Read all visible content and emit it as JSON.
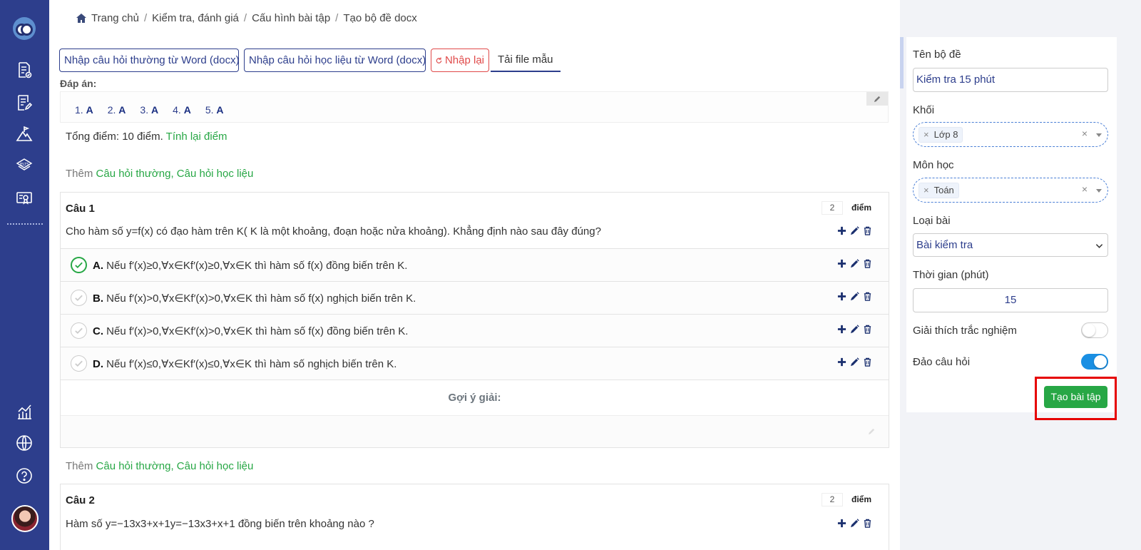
{
  "breadcrumb": {
    "home": "Trang chủ",
    "items": [
      "Kiểm tra, đánh giá",
      "Cấu hình bài tập",
      "Tạo bộ đề docx"
    ],
    "separator": "/"
  },
  "toolbar": {
    "import_normal": "Nhập câu hỏi thường từ Word (docx)",
    "import_material": "Nhập câu hỏi học liệu từ Word (docx)",
    "reset": "Nhập lại",
    "download_template": "Tải file mẫu"
  },
  "answers": {
    "label": "Đáp án:",
    "items": [
      {
        "num": "1.",
        "ans": "A"
      },
      {
        "num": "2.",
        "ans": "A"
      },
      {
        "num": "3.",
        "ans": "A"
      },
      {
        "num": "4.",
        "ans": "A"
      },
      {
        "num": "5.",
        "ans": "A"
      }
    ]
  },
  "total": {
    "prefix": "Tổng điểm: 10 điểm.",
    "recalc": "Tính lại điểm"
  },
  "add_row": {
    "prefix": "Thêm",
    "links": "Câu hỏi thường, Câu hỏi học liệu"
  },
  "questions": [
    {
      "title": "Câu 1",
      "points": "2",
      "points_label": "điểm",
      "text": "Cho hàm số y=f(x) có đạo hàm trên K( K là một khoảng, đoạn hoặc nửa khoảng). Khẳng định nào sau đây đúng?",
      "options": [
        {
          "letter": "A.",
          "text": "Nếu f′(x)≥0,∀x∈Kf′(x)≥0,∀x∈K thì hàm số f(x) đồng biến trên K.",
          "correct": true
        },
        {
          "letter": "B.",
          "text": "Nếu f′(x)>0,∀x∈Kf′(x)>0,∀x∈K thì hàm số f(x) nghịch biến trên K.",
          "correct": false
        },
        {
          "letter": "C.",
          "text": "Nếu f′(x)>0,∀x∈Kf′(x)>0,∀x∈K thì hàm số f(x) đồng biến trên K.",
          "correct": false
        },
        {
          "letter": "D.",
          "text": "Nếu f′(x)≤0,∀x∈Kf′(x)≤0,∀x∈K thì hàm số nghịch biến trên K.",
          "correct": false
        }
      ],
      "hint_title": "Gợi ý giải:"
    },
    {
      "title": "Câu 2",
      "points": "2",
      "points_label": "điểm",
      "text": "Hàm số y=−13x3+x+1y=−13x3+x+1 đồng biến trên khoảng nào ?"
    }
  ],
  "panel": {
    "name_label": "Tên bộ đề",
    "name_value": "Kiểm tra 15 phút",
    "grade_label": "Khối",
    "grade_tag": "Lớp 8",
    "subject_label": "Môn học",
    "subject_tag": "Toán",
    "type_label": "Loại bài",
    "type_value": "Bài kiểm tra",
    "time_label": "Thời gian (phút)",
    "time_value": "15",
    "explain_label": "Giải thích trắc nghiệm",
    "explain_on": false,
    "shuffle_label": "Đảo câu hỏi",
    "shuffle_on": true,
    "create_button": "Tạo bài tập"
  },
  "colors": {
    "sidebar": "#2d3e8c",
    "accent_green": "#27a745",
    "danger": "#e04a4a",
    "toggle_on": "#1a8fe3",
    "highlight": "#e60000"
  }
}
